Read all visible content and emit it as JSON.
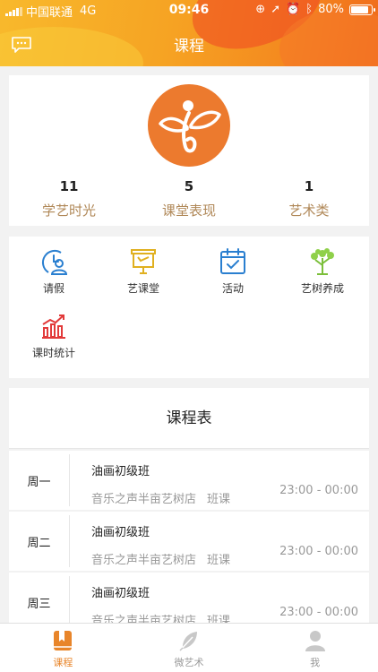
{
  "status_bar": {
    "carrier": "中国联通",
    "network": "4G",
    "time": "09:46",
    "battery": "80%"
  },
  "header": {
    "title": "课程"
  },
  "profile": {
    "stats": [
      {
        "value": "11",
        "label": "学艺时光"
      },
      {
        "value": "5",
        "label": "课堂表现"
      },
      {
        "value": "1",
        "label": "艺术类"
      }
    ]
  },
  "menu": {
    "items": [
      {
        "label": "请假",
        "icon": "leave-icon"
      },
      {
        "label": "艺课堂",
        "icon": "classroom-icon"
      },
      {
        "label": "活动",
        "icon": "calendar-icon"
      },
      {
        "label": "艺树养成",
        "icon": "tree-icon"
      },
      {
        "label": "课时统计",
        "icon": "stats-chart-icon"
      }
    ]
  },
  "schedule": {
    "title": "课程表",
    "rows": [
      {
        "day": "周一",
        "course": "油画初级班",
        "store": "音乐之声半亩艺树店",
        "type": "班课",
        "time": "23:00 - 00:00"
      },
      {
        "day": "周二",
        "course": "油画初级班",
        "store": "音乐之声半亩艺树店",
        "type": "班课",
        "time": "23:00 - 00:00"
      },
      {
        "day": "周三",
        "course": "油画初级班",
        "store": "音乐之声半亩艺树店",
        "type": "班课",
        "time": "23:00 - 00:00"
      }
    ]
  },
  "tabbar": {
    "tabs": [
      {
        "label": "课程",
        "active": true
      },
      {
        "label": "微艺术",
        "active": false
      },
      {
        "label": "我",
        "active": false
      }
    ]
  },
  "colors": {
    "accent": "#e8852a",
    "logo_bg": "#ec7a2e",
    "stat_label": "#b08858"
  }
}
